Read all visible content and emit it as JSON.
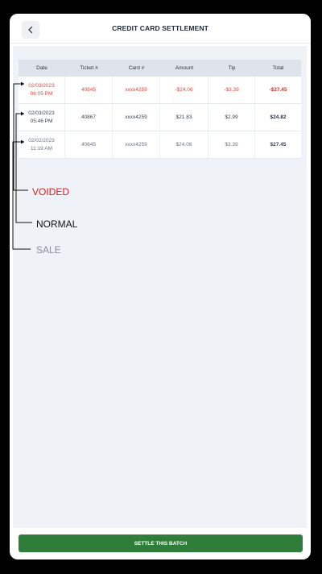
{
  "header": {
    "title": "CREDIT CARD SETTLEMENT"
  },
  "table": {
    "columns": [
      "Date",
      "Ticket #",
      "Card #",
      "Amount",
      "Tip",
      "Total"
    ],
    "rows": [
      {
        "type": "voided",
        "date_line1": "02/03/2023",
        "date_line2": "06:05 PM",
        "ticket": "40845",
        "card": "xxxx4259",
        "amount": "-$24.06",
        "tip": "-$3.39",
        "total": "-$27.45"
      },
      {
        "type": "normal",
        "date_line1": "02/03/2023",
        "date_line2": "05:46 PM",
        "ticket": "40867",
        "card": "xxxx4259",
        "amount": "$21.83",
        "tip": "$2.99",
        "total": "$24.82"
      },
      {
        "type": "sale",
        "date_line1": "02/02/2023",
        "date_line2": "11:19 AM",
        "ticket": "40845",
        "card": "xxxx4259",
        "amount": "$24.06",
        "tip": "$3.39",
        "total": "$27.45"
      }
    ]
  },
  "legend": {
    "voided": "VOIDED",
    "normal": "NORMAL",
    "sale": "SALE"
  },
  "footer": {
    "settle_label": "SETTLE THIS BATCH"
  },
  "colors": {
    "accent_green": "#2e7d38",
    "voided_red": "#e0453e"
  },
  "icons": {
    "back": "chevron-left-icon"
  }
}
